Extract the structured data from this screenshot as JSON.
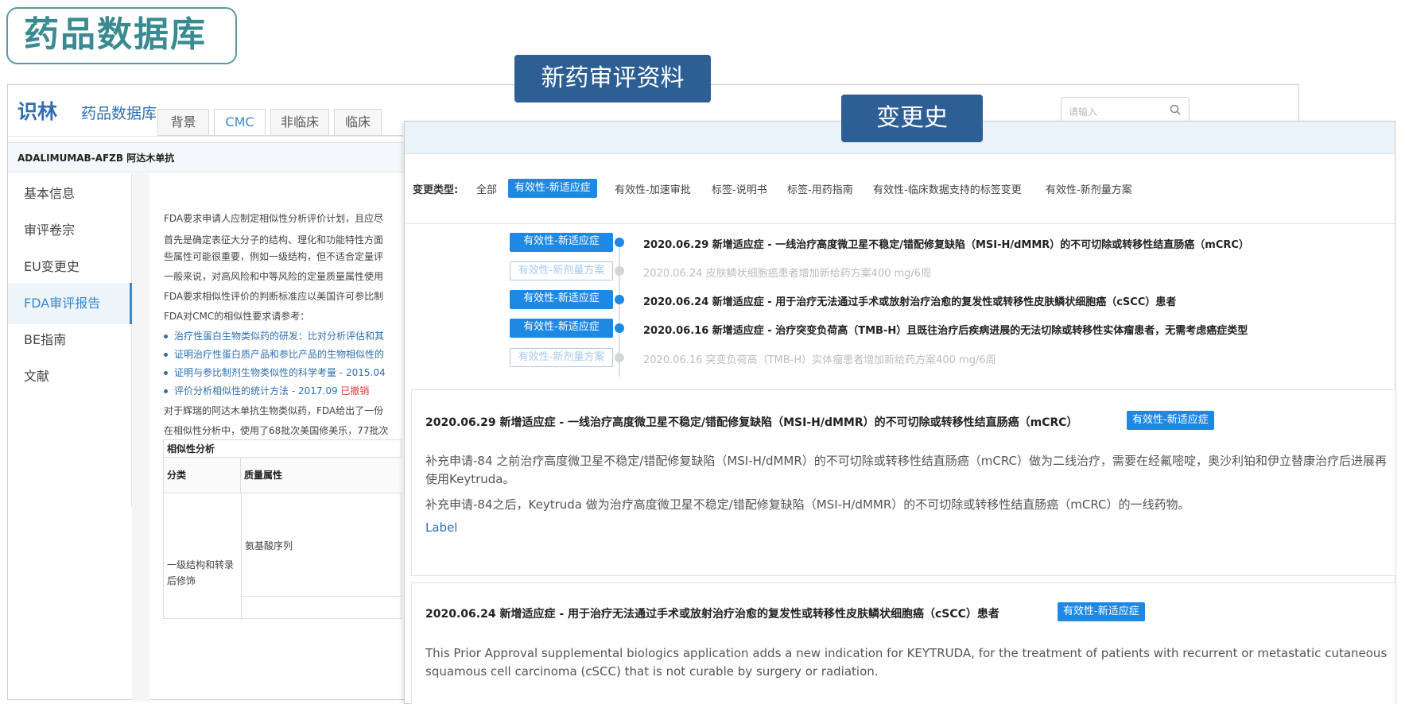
{
  "hero_title": "药品数据库",
  "labels": {
    "review": "新药审评资料",
    "history": "变更史"
  },
  "back": {
    "logo": "识林",
    "header_title": "药品数据库",
    "search_placeholder": "请输入",
    "drug_name": "ADALIMUMAB-AFZB 阿达木单抗",
    "sidebar": [
      "基本信息",
      "审评卷宗",
      "EU变更史",
      "FDA审评报告",
      "BE指南",
      "文献"
    ],
    "sidebar_active": "FDA审评报告",
    "tabs": [
      "背景",
      "CMC",
      "非临床",
      "临床"
    ],
    "tab_active": "CMC",
    "paragraphs": [
      "FDA要求申请人应制定相似性分析评价计划，且应尽",
      "首先是确定表征大分子的结构、理化和功能特性方面",
      "些属性可能很重要，例如一级结构，但不适合定量评",
      "一般来说，对高风险和中等风险的定量质量属性使用",
      "FDA要求相似性评价的判断标准应以美国许可参比制",
      "FDA对CMC的相似性要求请参考："
    ],
    "bullets": [
      {
        "text": "治疗性蛋白生物类似药的研发：比对分析评估和其",
        "rev": ""
      },
      {
        "text": "证明治疗性蛋白质产品和参比产品的生物相似性的",
        "rev": ""
      },
      {
        "text": "证明与参比制剂生物类似性的科学考量 - 2015.04",
        "rev": ""
      },
      {
        "text": "评价分析相似性的统计方法 - 2017.09 ",
        "rev": "已撤销"
      }
    ],
    "paragraphs2": [
      "对于辉瑞的阿达木单抗生物类似药，FDA给出了一份",
      "在相似性分析中，使用了68批次美国修美乐，77批次"
    ],
    "table": {
      "title": "相似性分析",
      "headers": [
        "分类",
        "质量属性"
      ],
      "category": "一级结构和转录后修饰",
      "attribute": "氨基酸序列"
    }
  },
  "front": {
    "filter_label": "变更类型:",
    "filters": [
      "全部",
      "有效性-新适应症",
      "有效性-加速审批",
      "标签-说明书",
      "标签-用药指南",
      "有效性-临床数据支持的标签变更",
      "有效性-新剂量方案"
    ],
    "filter_active": "有效性-新适应症",
    "timeline": [
      {
        "badge": "有效性-新适应症",
        "on": true,
        "text": "2020.06.29 新增适应症 - 一线治疗高度微卫星不稳定/错配修复缺陷（MSI-H/dMMR）的不可切除或转移性结直肠癌（mCRC）"
      },
      {
        "badge": "有效性-新剂量方案",
        "on": false,
        "text": "2020.06.24 皮肤鳞状细胞癌患者增加新给药方案400 mg/6周"
      },
      {
        "badge": "有效性-新适应症",
        "on": true,
        "text": "2020.06.24 新增适应症 - 用于治疗无法通过手术或放射治疗治愈的复发性或转移性皮肤鳞状细胞癌（cSCC）患者"
      },
      {
        "badge": "有效性-新适应症",
        "on": true,
        "text": "2020.06.16 新增适应症 - 治疗突变负荷高（TMB-H）且既往治疗后疾病进展的无法切除或转移性实体瘤患者，无需考虑癌症类型"
      },
      {
        "badge": "有效性-新剂量方案",
        "on": false,
        "text": "2020.06.16 突变负荷高（TMB-H）实体瘤患者增加新给药方案400 mg/6周"
      }
    ],
    "card1": {
      "title": "2020.06.29 新增适应症 - 一线治疗高度微卫星不稳定/错配修复缺陷（MSI-H/dMMR）的不可切除或转移性结直肠癌（mCRC）",
      "badge": "有效性-新适应症",
      "text1": "补充申请-84 之前治疗高度微卫星不稳定/错配修复缺陷（MSI-H/dMMR）的不可切除或转移性结直肠癌（mCRC）做为二线治疗，需要在经氟嘧啶，奥沙利铂和伊立替康治疗后进展再使用Keytruda。",
      "text2": "补充申请-84之后，Keytruda 做为治疗高度微卫星不稳定/错配修复缺陷（MSI-H/dMMR）的不可切除或转移性结直肠癌（mCRC）的一线药物。",
      "link": "Label"
    },
    "card2": {
      "title": "2020.06.24 新增适应症 - 用于治疗无法通过手术或放射治疗治愈的复发性或转移性皮肤鳞状细胞癌（cSCC）患者",
      "badge": "有效性-新适应症",
      "text": "This Prior Approval supplemental biologics application adds a new indication for KEYTRUDA, for the treatment of patients with recurrent or metastatic cutaneous squamous cell carcinoma (cSCC) that is not curable by surgery or radiation."
    }
  }
}
